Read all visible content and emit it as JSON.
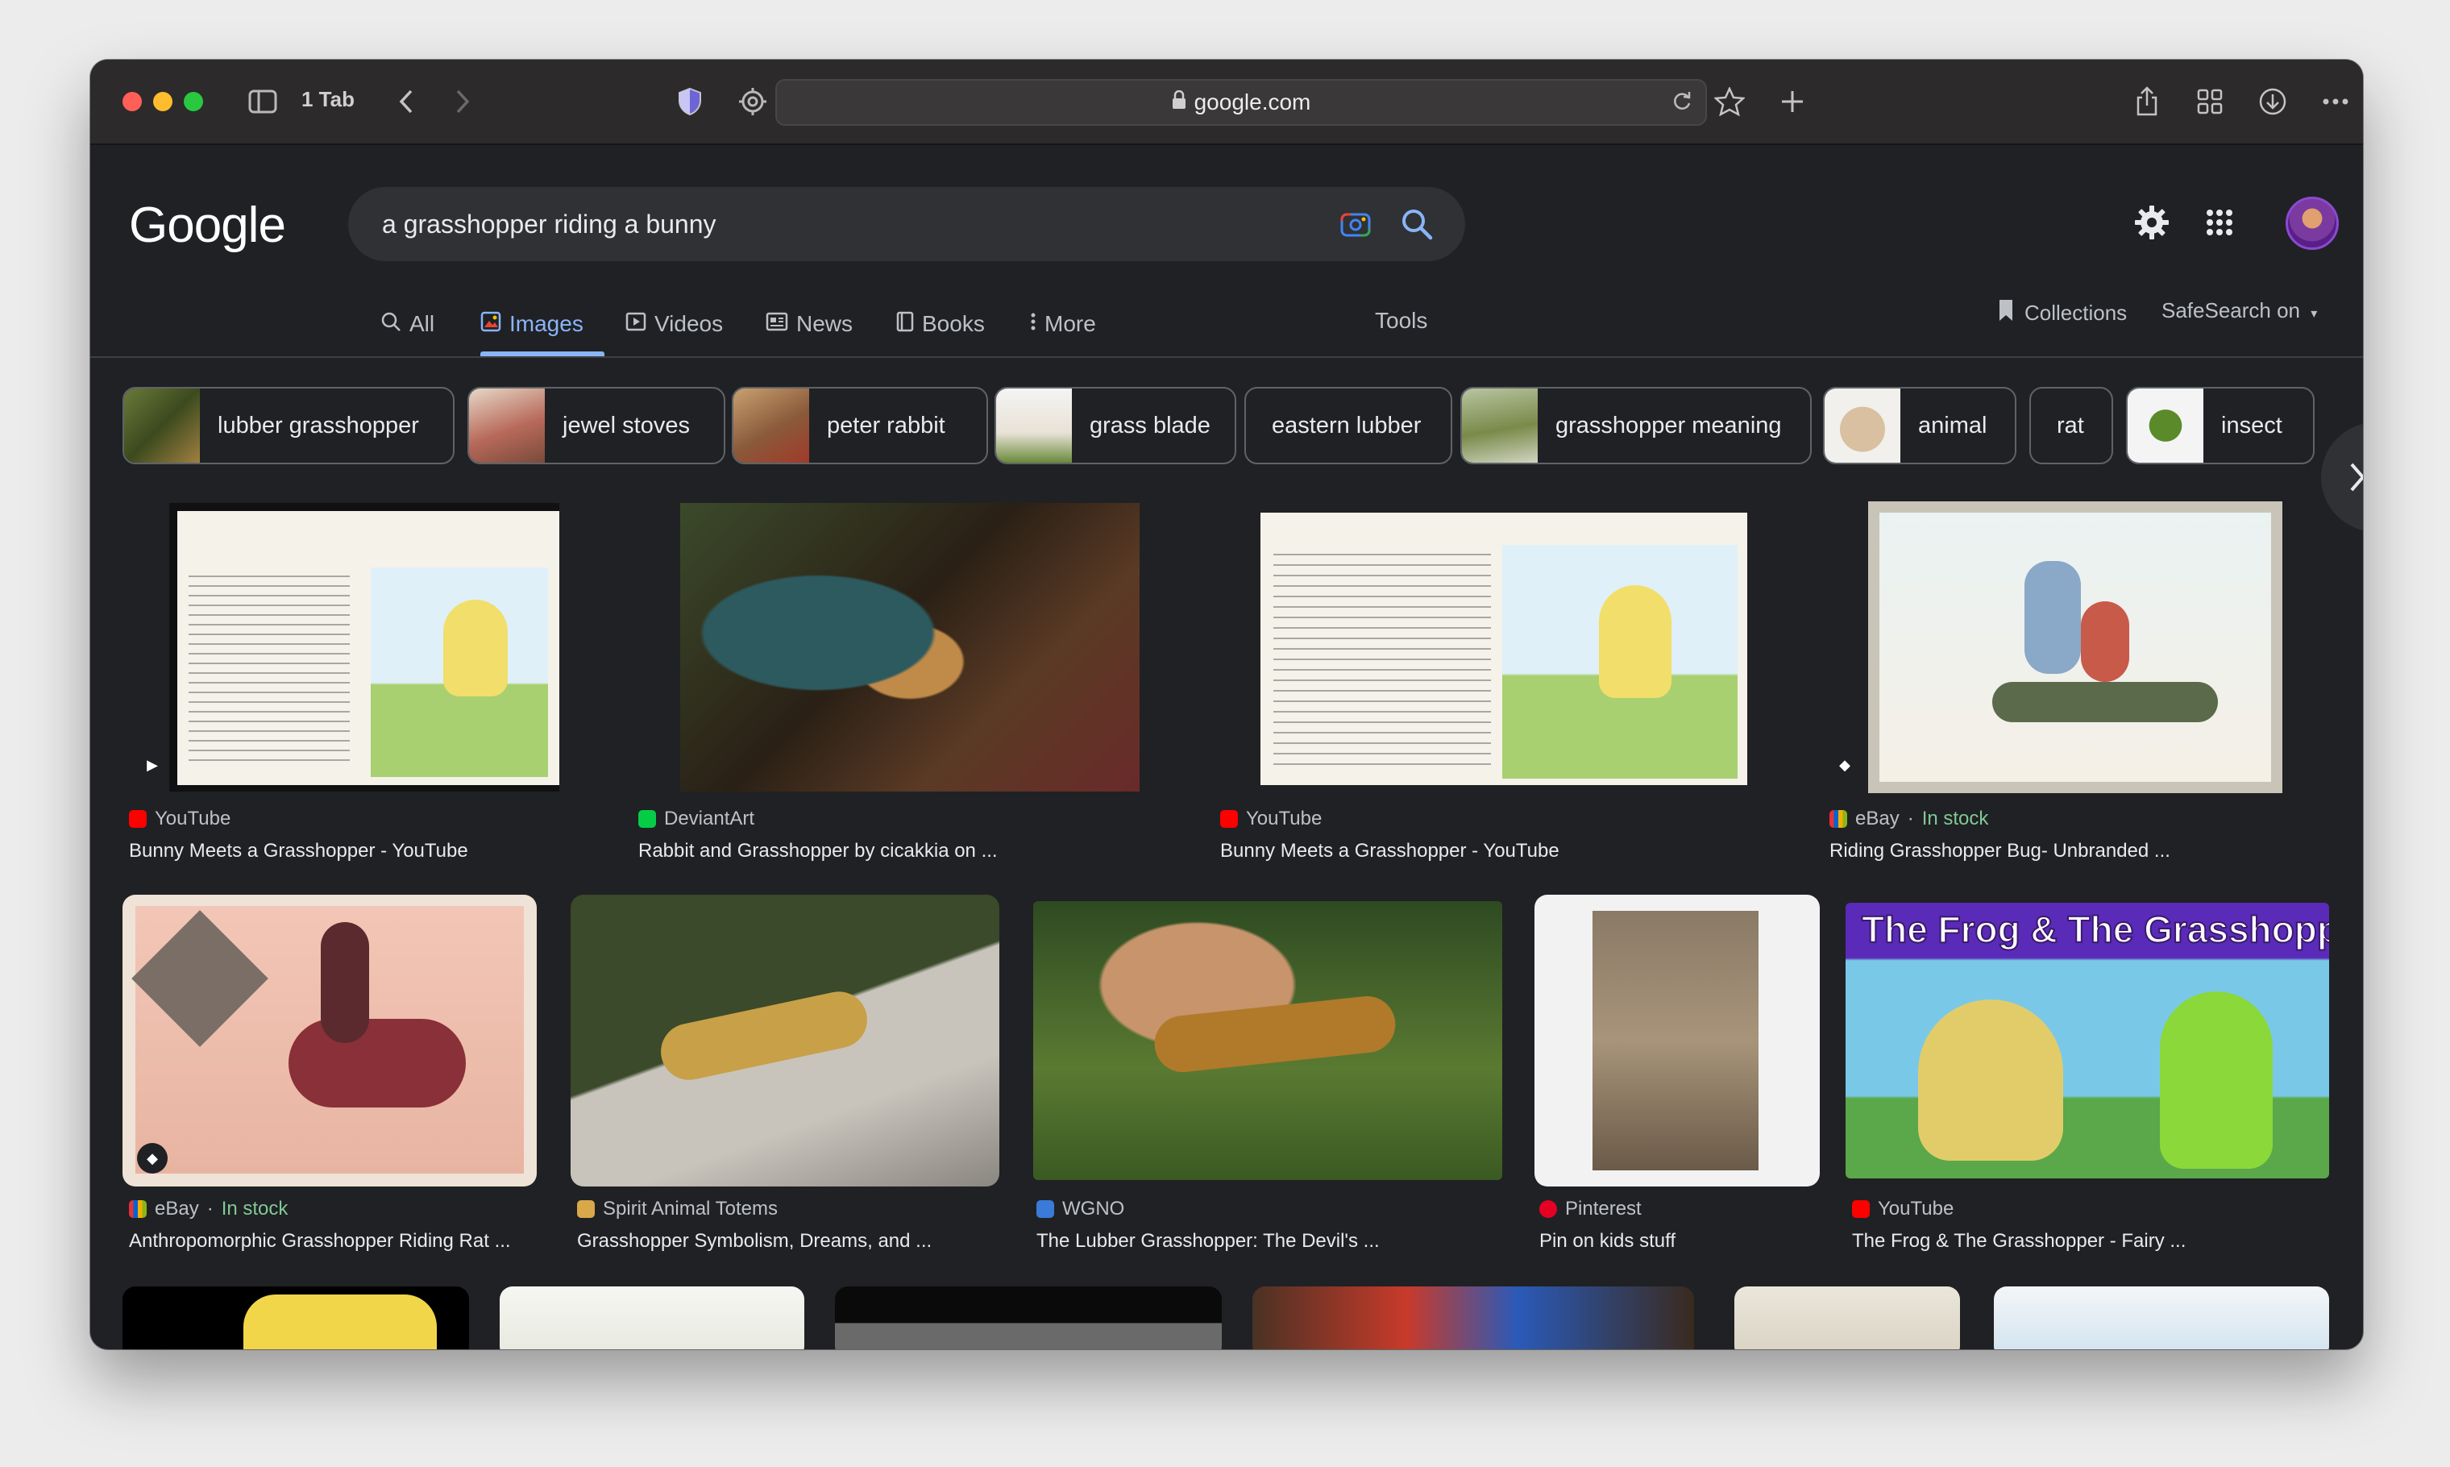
{
  "browser": {
    "tab_count": "1 Tab",
    "url": "google.com"
  },
  "google": {
    "logo": "Google",
    "query": "a grasshopper riding a bunny"
  },
  "nav": {
    "tabs": [
      {
        "label": "All"
      },
      {
        "label": "Images"
      },
      {
        "label": "Videos"
      },
      {
        "label": "News"
      },
      {
        "label": "Books"
      },
      {
        "label": "More"
      }
    ],
    "tools": "Tools",
    "collections": "Collections",
    "safesearch": "SafeSearch on"
  },
  "chips": [
    {
      "label": "lubber grasshopper"
    },
    {
      "label": "jewel stoves"
    },
    {
      "label": "peter rabbit"
    },
    {
      "label": "grass blade"
    },
    {
      "label": "eastern lubber"
    },
    {
      "label": "grasshopper meaning"
    },
    {
      "label": "animal"
    },
    {
      "label": "rat"
    },
    {
      "label": "insect"
    }
  ],
  "results": [
    {
      "source": "YouTube",
      "title": "Bunny Meets a Grasshopper - YouTube"
    },
    {
      "source": "DeviantArt",
      "title": "Rabbit and Grasshopper by cicakkia on ..."
    },
    {
      "source": "YouTube",
      "title": "Bunny Meets a Grasshopper - YouTube"
    },
    {
      "source": "eBay",
      "stock": "In stock",
      "title": "Riding Grasshopper Bug- Unbranded ..."
    },
    {
      "source": "eBay",
      "stock": "In stock",
      "title": "Anthropomorphic Grasshopper Riding Rat ..."
    },
    {
      "source": "Spirit Animal Totems",
      "title": "Grasshopper Symbolism, Dreams, and ..."
    },
    {
      "source": "WGNO",
      "title": "The Lubber Grasshopper: The Devil's ..."
    },
    {
      "source": "Pinterest",
      "title": "Pin on kids stuff"
    },
    {
      "source": "YouTube",
      "title": "The Frog & The Grasshopper - Fairy ..."
    }
  ],
  "frog_thumb_text": "The Frog & The Grasshopper",
  "colors": {
    "background": "#202124",
    "accent": "#8ab4f8",
    "in_stock": "#81c995"
  }
}
